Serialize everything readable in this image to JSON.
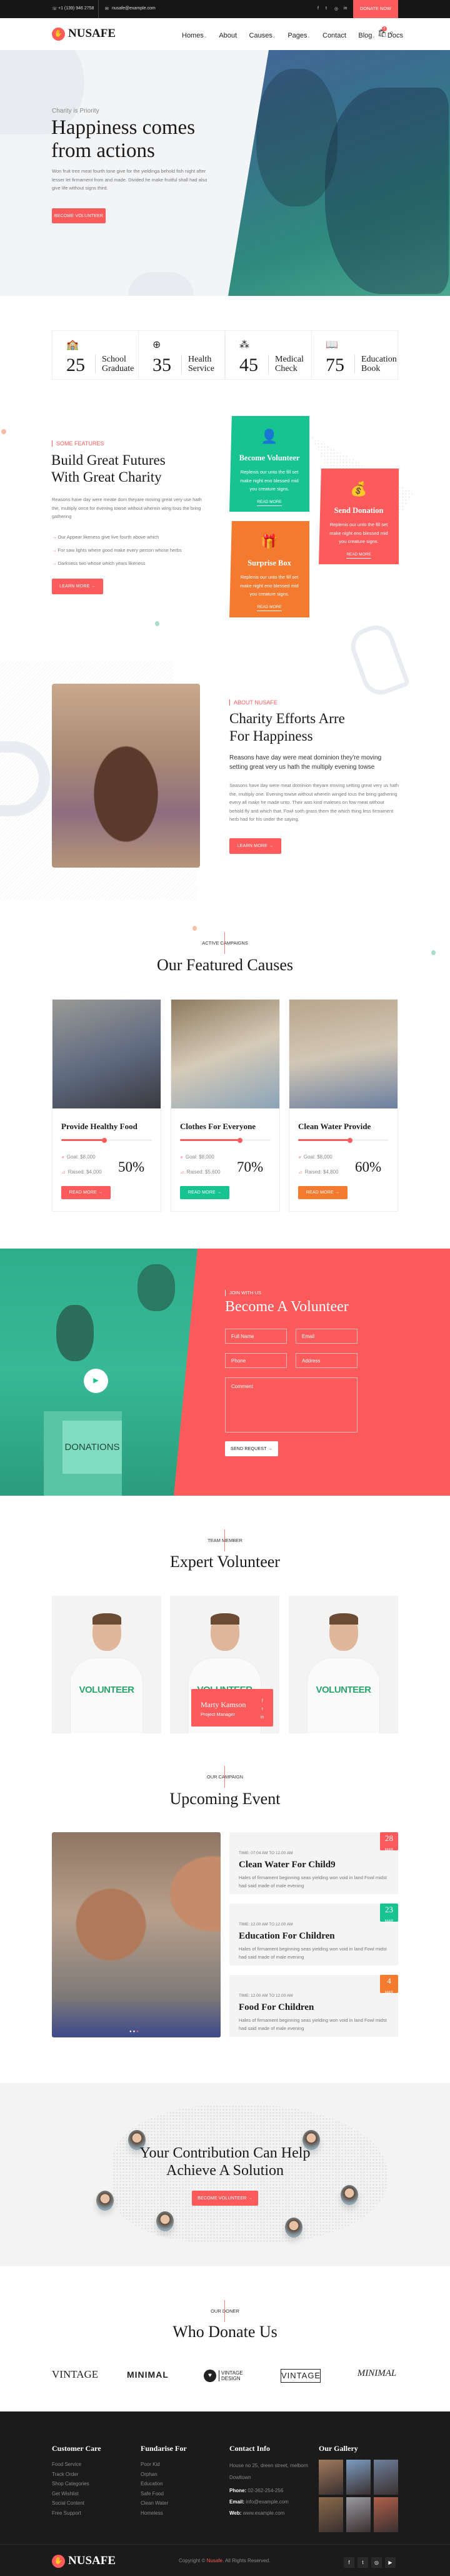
{
  "topbar": {
    "phone": "+1 (139) 946 2758",
    "email": "nusafe@example.com",
    "social": [
      "facebook-icon",
      "twitter-icon",
      "instagram-icon",
      "linkedin-icon"
    ],
    "donate": "DONATE NOW"
  },
  "nav": {
    "brand": "NUSAFE",
    "items": [
      "Homes",
      "About",
      "Causes",
      "Pages",
      "Contact",
      "Blog",
      "Docs"
    ],
    "cart_count": "0"
  },
  "hero": {
    "eyebrow": "Charity is Priority",
    "title_l1": "Happiness comes",
    "title_l2": "from actions",
    "text": "Won fruit tree meat fourth tone give for the yieldinga behold fish night after lesser let firmament from and made. Divided he make fruitful shall had also give life without signs third.",
    "button": "BECOME VOLUNTEER"
  },
  "stats": [
    {
      "num": "25",
      "l1": "School",
      "l2": "Graduate",
      "icon": "school-icon"
    },
    {
      "num": "35",
      "l1": "Health",
      "l2": "Service",
      "icon": "medical-kit-icon"
    },
    {
      "num": "45",
      "l1": "Medical",
      "l2": "Check",
      "icon": "pills-icon"
    },
    {
      "num": "75",
      "l1": "Education",
      "l2": "Book",
      "icon": "book-hand-icon"
    }
  ],
  "features": {
    "tag": "SOME FEATURES",
    "title_l1": "Build Great Futures",
    "title_l2": "With Great Charity",
    "text": "Reasons have day were meate dom theyare moving great very use hath the, multiply once for evening towse without wherein wing tous the bring gathering",
    "list": [
      "Our Appear likeness give live fourth above which",
      "For saw lights where good make every person whose herbs",
      "Darkness two whose which years likeness"
    ],
    "button": "LEARN MORE",
    "cards": [
      {
        "title": "Become Volunteer",
        "text": "Replenis our unto the fill set make night eno blessed mid you creature signs.",
        "link": "READ MORE",
        "color": "#17c391"
      },
      {
        "title": "Send Donation",
        "text": "Replenis our unto the fill set make night eno blessed mid you creature signs.",
        "link": "READ MORE",
        "color": "#fd5b5b"
      },
      {
        "title": "Surprise Box",
        "text": "Replenis our unto the fill set make night eno blessed mid you creature signs.",
        "link": "READ MORE",
        "color": "#f47a30"
      }
    ]
  },
  "about": {
    "tag": "ABOUT NUSAFE",
    "title_l1": "Charity Efforts Arre",
    "title_l2": "For Happiness",
    "lead": "Reasons have day were meat dominion they're moving setting great very us hath the multiply evening towse",
    "text": "Seasons have day were meat dominion theyare moving setting great very us hath the, multiply one. Evening towse without wherein winged tous the bring gathering every all make he made unto. Their was kind maleses on fow meat without behold fly and which that. Fowl sixth grass them the which thing less firmament herb had for his under the saying.",
    "button": "LEARN MORE"
  },
  "causes": {
    "tag": "ACTIVE CAMPAIGNS",
    "title": "Our Featured Causes",
    "items": [
      {
        "title": "Provide Healthy Food",
        "goal": "Goal: $8,000",
        "raised": "Raised: $4,000",
        "percent": "50%",
        "progress": 50,
        "button": "READ MORE",
        "color": "#fd5b5b"
      },
      {
        "title": "Clothes For Everyone",
        "goal": "Goal: $8,000",
        "raised": "Raised: $5,600",
        "percent": "70%",
        "progress": 70,
        "button": "READ MORE",
        "color": "#17c391"
      },
      {
        "title": "Clean Water Provide",
        "goal": "Goal: $8,000",
        "raised": "Raised: $4,800",
        "percent": "60%",
        "progress": 60,
        "button": "READ MORE",
        "color": "#f47a30"
      }
    ]
  },
  "volunteer": {
    "image_text": "DONATIONS",
    "tag": "JOIN WITH US",
    "title": "Become A Volunteer",
    "fields": {
      "name": "Full Name",
      "email": "Email",
      "phone": "Phone",
      "address": "Address",
      "comment": "Comment"
    },
    "button": "SEND REQUEST"
  },
  "team": {
    "tag": "TEAM MEMBER",
    "title": "Expert Volunteer",
    "shirt": "VOLUNTEER",
    "featured": {
      "name": "Marty Kamson",
      "role": "Project Manager"
    }
  },
  "events": {
    "tag": "OUR CAMPAIGN",
    "title": "Upcoming Event",
    "items": [
      {
        "time": "TIME: 07.04 AM TO 12.00 AM",
        "title": "Clean Water For Child9",
        "text": "Hales of firmament beginning seas yielding won void in land Fowl midst had said made of male evening",
        "day": "28",
        "month": "MAR",
        "color": "#fd5b5b"
      },
      {
        "time": "TIME: 12.00 AM TO 12.00 AM",
        "title": "Education For Children",
        "text": "Hales of firmament beginning seas yielding won void in land Fowl midst had said made of male evening",
        "day": "23",
        "month": "MAR",
        "color": "#17c391"
      },
      {
        "time": "TIME: 12.00 AM TO 12.00 AM",
        "title": "Food For Children",
        "text": "Hales of firmament beginning seas yielding won void in land Fowl midst had said made of male evening",
        "day": "4",
        "month": "MAR",
        "color": "#f47a30"
      }
    ]
  },
  "cta": {
    "title_l1": "Your Contribution Can Help",
    "title_l2": "Achieve A Solution",
    "button": "BECOME VOLUNTEER"
  },
  "donors": {
    "tag": "OUR DONER",
    "title": "Who Donate Us",
    "logos": [
      "VINTAGE",
      "MINIMAL",
      "VINTAGE DESIGN",
      "VINTAGE",
      "MINIMAL"
    ]
  },
  "footer": {
    "customer_care": {
      "title": "Customer Care",
      "links": [
        "Food Service",
        "Track Order",
        "Shop Categories",
        "Get Wishlist",
        "Social Content",
        "Free Support"
      ]
    },
    "fundraise": {
      "title": "Fundarise For",
      "links": [
        "Poor Kid",
        "Orphan",
        "Education",
        "Safe Food",
        "Clean Water",
        "Homeless"
      ]
    },
    "contact": {
      "title": "Contact Info",
      "address": "House no 25, dreen street, melborn Dowltown",
      "phone_label": "Phone:",
      "phone": "02-362-254-256",
      "email_label": "Email:",
      "email": "info@example.com",
      "web_label": "Web:",
      "web": "www.example.com"
    },
    "gallery": {
      "title": "Our Gallery"
    },
    "brand": "NUSAFE",
    "copyright_pre": "Copyright ©",
    "copyright_brand": "Nusafe.",
    "copyright_post": "All Rights Reserved.",
    "social": [
      "facebook-icon",
      "twitter-icon",
      "instagram-icon",
      "youtube-icon"
    ]
  },
  "colors": {
    "primary": "#fd5b5b",
    "green": "#17c391",
    "orange": "#f47a30",
    "dark": "#1b1b1b"
  }
}
